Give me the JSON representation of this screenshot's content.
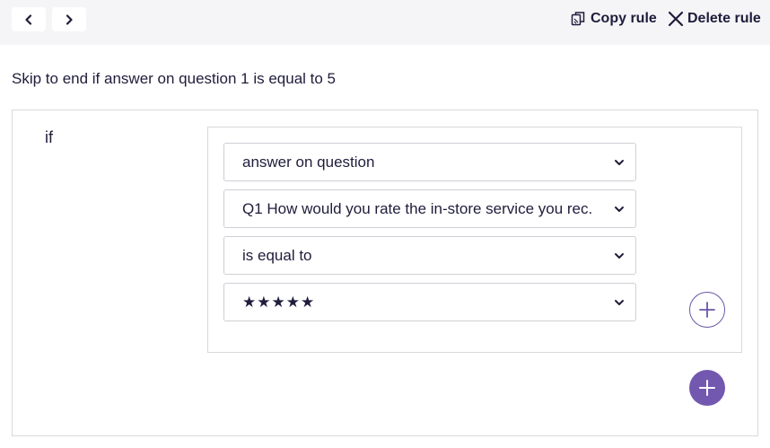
{
  "toolbar": {
    "copy_label": "Copy rule",
    "delete_label": "Delete rule"
  },
  "rule": {
    "summary": "Skip to end if answer on question 1 is equal to 5",
    "if_label": "if",
    "conditions": [
      {
        "value": "answer on question"
      },
      {
        "value": "Q1 How would you rate the in-store service you rec."
      },
      {
        "value": "is equal to"
      },
      {
        "value": "★★★★★"
      }
    ]
  },
  "colors": {
    "accent": "#7358b0",
    "text": "#1f1d3b",
    "border": "#d9d9de",
    "topbar_bg": "#f5f5f7"
  }
}
